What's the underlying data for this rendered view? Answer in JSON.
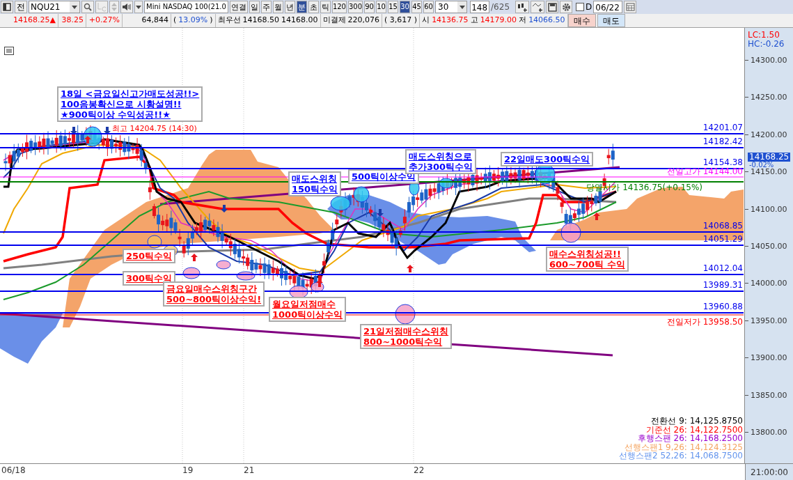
{
  "toolbar": {
    "prefix": "전",
    "symbol": "NQU21",
    "product": "Mini NASDAQ 100(21.0",
    "periods": [
      {
        "label": "연결",
        "selected": false
      },
      {
        "label": "일",
        "selected": false
      },
      {
        "label": "주",
        "selected": false
      },
      {
        "label": "월",
        "selected": false
      },
      {
        "label": "년",
        "selected": false
      },
      {
        "label": "분",
        "selected": true
      },
      {
        "label": "초",
        "selected": false
      },
      {
        "label": "틱",
        "selected": false
      }
    ],
    "intervals": [
      {
        "label": "120",
        "selected": false
      },
      {
        "label": "300",
        "selected": false
      },
      {
        "label": "90",
        "selected": false
      },
      {
        "label": "10",
        "selected": false
      },
      {
        "label": "15",
        "selected": false
      },
      {
        "label": "30",
        "selected": true
      },
      {
        "label": "45",
        "selected": false
      },
      {
        "label": "60",
        "selected": false
      }
    ],
    "interval_value": "30",
    "count": "148",
    "total": "/625",
    "d_checked": false,
    "d_label": "D",
    "date": "06/22"
  },
  "quote": {
    "last": "14168.25▲",
    "change": "38.25",
    "change_pct": "+0.27%",
    "volume": "64,844",
    "volume_pct_open": "(",
    "volume_pct": "13.09%",
    "volume_pct_close": ")",
    "best_label": "최우선",
    "ask": "14168.50",
    "bid": "14168.00",
    "oi_label": "미결제",
    "oi": "220,076",
    "oi_change": "( 3,617 )",
    "open_label": "시",
    "open": "14136.75",
    "high_label": "고",
    "high": "14179.00",
    "low_label": "저",
    "low": "14066.50",
    "buy": "매수",
    "sell": "매도"
  },
  "chart": {
    "lc": "LC:1.50",
    "hc": "HC:-0.26",
    "y_ticks": [
      "14300.00",
      "14250.00",
      "14200.00",
      "14150.00",
      "14100.00",
      "14050.00",
      "14000.00",
      "13950.00",
      "13900.00",
      "13850.00",
      "13800.00"
    ],
    "price_tag": "14168.25",
    "price_change": "-0.02%",
    "levels": [
      {
        "value": "14201.07"
      },
      {
        "value": "14182.42"
      },
      {
        "value": "14154.38"
      },
      {
        "value": "14068.85"
      },
      {
        "value": "14051.29"
      },
      {
        "value": "14012.04"
      },
      {
        "value": "13989.31"
      },
      {
        "value": "13960.88"
      }
    ],
    "reference_labels": [
      {
        "text": "전일고가 14144.00",
        "color": "#ff00ff"
      },
      {
        "text": "당일시가 14136.75(+0.15%)",
        "color": "#008000"
      },
      {
        "text": "전일저가 13958.50",
        "color": "#ff0000"
      }
    ],
    "high_marker": "최고 14204.75 (14:30)",
    "annotations": [
      {
        "lines": [
          "18일  <금요일신고가매도성공!!>",
          "100음봉확신으로 시황설명!!",
          "★900틱이상 수익성공!!★"
        ],
        "color": "#0000ff"
      },
      {
        "lines": [
          "매도스위칭",
          "150틱수익"
        ],
        "color": "#0000ff"
      },
      {
        "lines": [
          "500틱이상수익"
        ],
        "color": "#0000ff"
      },
      {
        "lines": [
          "매도스위칭으로",
          "추가300틱수익"
        ],
        "color": "#0000ff"
      },
      {
        "lines": [
          "22일매도300틱수익"
        ],
        "color": "#0000ff"
      },
      {
        "lines": [
          "250틱수익"
        ],
        "color": "#ff0000"
      },
      {
        "lines": [
          "300틱수익"
        ],
        "color": "#ff0000"
      },
      {
        "lines": [
          "금요일매수스위칭구간",
          "500~800틱이상수익!"
        ],
        "color": "#ff0000"
      },
      {
        "lines": [
          "월요일저점매수",
          "1000틱이상수익"
        ],
        "color": "#ff0000"
      },
      {
        "lines": [
          "21일저점매수스위칭",
          "800~1000틱수익"
        ],
        "color": "#ff0000"
      },
      {
        "lines": [
          "매수스위칭성공!!",
          "600~700틱 수익"
        ],
        "color": "#ff0000"
      }
    ],
    "legend": [
      {
        "text": "전환선 9: 14,125.8750",
        "color": "#000000"
      },
      {
        "text": "기준선 26: 14,122.7500",
        "color": "#ff0000"
      },
      {
        "text": "후행스팬 26: 14,168.2500",
        "color": "#9900cc"
      },
      {
        "text": "선행스팬1 9,26: 14,124.3125",
        "color": "#f4a460"
      },
      {
        "text": "선행스팬2 52,26: 14,068.7500",
        "color": "#6495ed"
      }
    ],
    "x_labels": [
      "06/18",
      "19",
      "21",
      "22"
    ],
    "time_label": "21:00:00"
  }
}
